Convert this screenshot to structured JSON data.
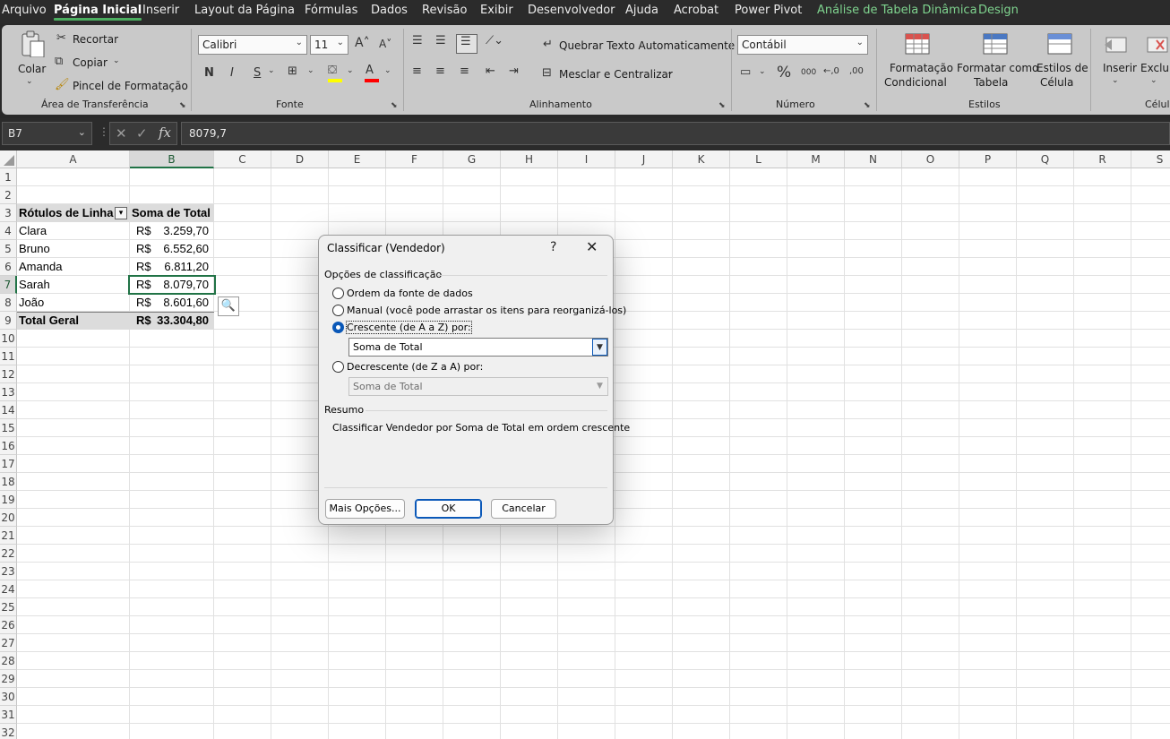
{
  "menu": {
    "tabs": [
      "Arquivo",
      "Página Inicial",
      "Inserir",
      "Layout da Página",
      "Fórmulas",
      "Dados",
      "Revisão",
      "Exibir",
      "Desenvolvedor",
      "Ajuda",
      "Acrobat",
      "Power Pivot",
      "Análise de Tabela Dinâmica",
      "Design"
    ],
    "active": "Página Inicial"
  },
  "ribbon": {
    "clipboard": {
      "paste": "Colar",
      "cut": "Recortar",
      "copy": "Copiar",
      "format_painter": "Pincel de Formatação",
      "label": "Área de Transferência"
    },
    "font": {
      "name": "Calibri",
      "size": "11",
      "label": "Fonte",
      "bold": "N",
      "italic": "I",
      "underline": "S"
    },
    "alignment": {
      "wrap": "Quebrar Texto Automaticamente",
      "merge": "Mesclar e Centralizar",
      "label": "Alinhamento"
    },
    "number": {
      "format": "Contábil",
      "label": "Número",
      "percent": "%",
      "thousands": "000",
      "dec_inc": "←,0",
      "dec_dec": ",00"
    },
    "styles": {
      "cond_format_1": "Formatação",
      "cond_format_2": "Condicional",
      "table_1": "Formatar como",
      "table_2": "Tabela",
      "cell_1": "Estilos de",
      "cell_2": "Célula",
      "label": "Estilos"
    },
    "cells": {
      "insert": "Inserir",
      "delete": "Excluir",
      "label": "Célula"
    }
  },
  "formula_bar": {
    "name_box": "B7",
    "value": "8079,7"
  },
  "grid": {
    "columns": [
      "A",
      "B",
      "C",
      "D",
      "E",
      "F",
      "G",
      "H",
      "I",
      "J",
      "K",
      "L",
      "M",
      "N",
      "O",
      "P",
      "Q",
      "R",
      "S"
    ],
    "rows": [
      "1",
      "2",
      "3",
      "4",
      "5",
      "6",
      "7",
      "8",
      "9",
      "10",
      "11",
      "12",
      "13",
      "14",
      "15",
      "16",
      "17",
      "18",
      "19",
      "20",
      "21",
      "22",
      "23",
      "24",
      "25",
      "26",
      "27",
      "28",
      "29",
      "30",
      "31",
      "32"
    ],
    "pivot": {
      "header_a": "Rótulos de Linha",
      "header_b": "Soma de Total",
      "currency": "R$",
      "rows": [
        {
          "name": "Clara",
          "value": "3.259,70"
        },
        {
          "name": "Bruno",
          "value": "6.552,60"
        },
        {
          "name": "Amanda",
          "value": "6.811,20"
        },
        {
          "name": "Sarah",
          "value": "8.079,70"
        },
        {
          "name": "João",
          "value": "8.601,60"
        }
      ],
      "total_label": "Total Geral",
      "total_value": "33.304,80"
    }
  },
  "dialog": {
    "title": "Classificar (Vendedor)",
    "help": "?",
    "close": "✕",
    "options_label": "Opções de classificação",
    "opt_source": "Ordem da fonte de dados",
    "opt_manual": "Manual (você pode arrastar os itens para reorganizá-los)",
    "opt_asc": "Crescente (de A a Z) por:",
    "asc_value": "Soma de Total",
    "opt_desc": "Decrescente (de Z a A) por:",
    "desc_value": "Soma de Total",
    "summary_label": "Resumo",
    "summary_text": "Classificar Vendedor por Soma de Total em ordem crescente",
    "more_options": "Mais Opções...",
    "ok": "OK",
    "cancel": "Cancelar"
  }
}
